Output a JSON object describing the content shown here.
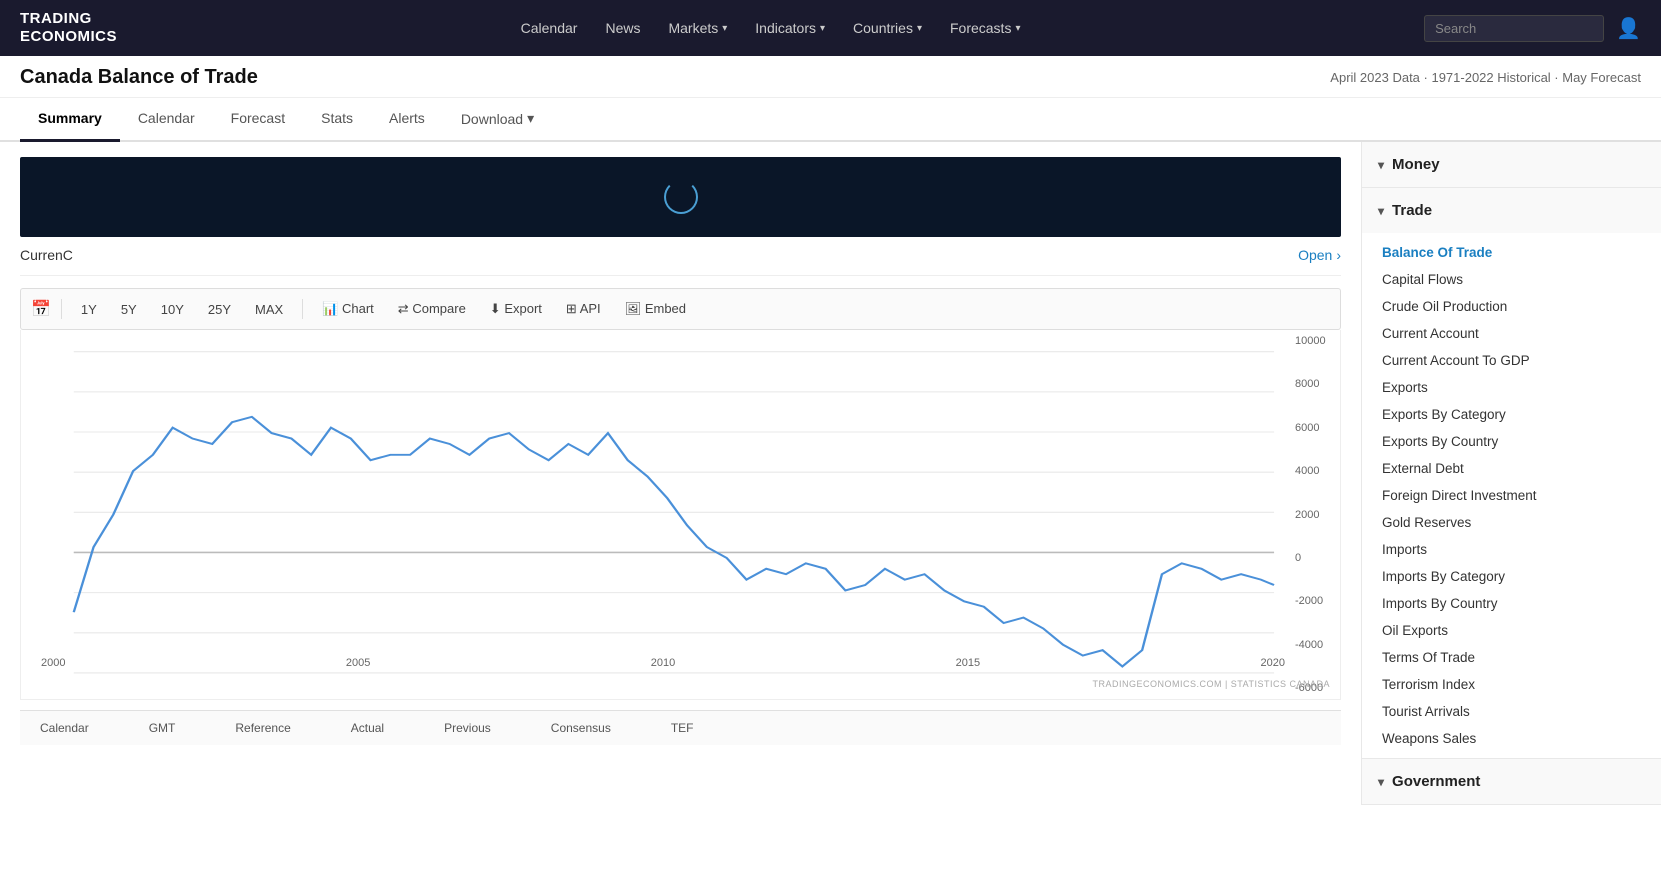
{
  "header": {
    "logo_line1": "TRADING",
    "logo_line2": "ECONOMICS",
    "nav": [
      {
        "label": "Calendar",
        "has_dropdown": false
      },
      {
        "label": "News",
        "has_dropdown": false
      },
      {
        "label": "Markets",
        "has_dropdown": true
      },
      {
        "label": "Indicators",
        "has_dropdown": true
      },
      {
        "label": "Countries",
        "has_dropdown": true
      },
      {
        "label": "Forecasts",
        "has_dropdown": true
      }
    ],
    "search_placeholder": "Search"
  },
  "page": {
    "title": "Canada Balance of Trade",
    "subtitle": "April 2023 Data · 1971-2022 Historical · May Forecast"
  },
  "tabs": [
    {
      "label": "Summary",
      "active": true
    },
    {
      "label": "Calendar",
      "active": false
    },
    {
      "label": "Forecast",
      "active": false
    },
    {
      "label": "Stats",
      "active": false
    },
    {
      "label": "Alerts",
      "active": false
    },
    {
      "label": "Download",
      "active": false,
      "has_dropdown": true
    }
  ],
  "currenc": {
    "label": "CurrenC",
    "open_text": "Open"
  },
  "chart_controls": {
    "time_periods": [
      "1Y",
      "5Y",
      "10Y",
      "25Y",
      "MAX"
    ],
    "actions": [
      {
        "label": "Chart",
        "icon": "📊"
      },
      {
        "label": "Compare",
        "icon": "⇄"
      },
      {
        "label": "Export",
        "icon": "⬇"
      },
      {
        "label": "API",
        "icon": "⊞"
      },
      {
        "label": "Embed",
        "icon": "🖼"
      }
    ]
  },
  "chart": {
    "y_labels": [
      "10000",
      "8000",
      "6000",
      "4000",
      "2000",
      "0",
      "-2000",
      "-4000",
      "-6000"
    ],
    "x_labels": [
      "2000",
      "2005",
      "2010",
      "2015",
      "2020"
    ],
    "watermark": "TRADINGECONOMICS.COM | STATISTICS CANADA"
  },
  "sidebar": {
    "sections": [
      {
        "label": "Money",
        "expanded": false,
        "items": []
      },
      {
        "label": "Trade",
        "expanded": true,
        "items": [
          {
            "label": "Balance Of Trade",
            "active": true
          },
          {
            "label": "Capital Flows",
            "active": false
          },
          {
            "label": "Crude Oil Production",
            "active": false
          },
          {
            "label": "Current Account",
            "active": false
          },
          {
            "label": "Current Account To GDP",
            "active": false
          },
          {
            "label": "Exports",
            "active": false
          },
          {
            "label": "Exports By Category",
            "active": false
          },
          {
            "label": "Exports By Country",
            "active": false
          },
          {
            "label": "External Debt",
            "active": false
          },
          {
            "label": "Foreign Direct Investment",
            "active": false
          },
          {
            "label": "Gold Reserves",
            "active": false
          },
          {
            "label": "Imports",
            "active": false
          },
          {
            "label": "Imports By Category",
            "active": false
          },
          {
            "label": "Imports By Country",
            "active": false
          },
          {
            "label": "Oil Exports",
            "active": false
          },
          {
            "label": "Terms Of Trade",
            "active": false
          },
          {
            "label": "Terrorism Index",
            "active": false
          },
          {
            "label": "Tourist Arrivals",
            "active": false
          },
          {
            "label": "Weapons Sales",
            "active": false
          }
        ]
      },
      {
        "label": "Government",
        "expanded": false,
        "items": []
      }
    ]
  },
  "bottom_table": {
    "columns": [
      "Calendar",
      "GMT",
      "Reference",
      "Actual",
      "Previous",
      "Consensus",
      "TEF"
    ]
  }
}
